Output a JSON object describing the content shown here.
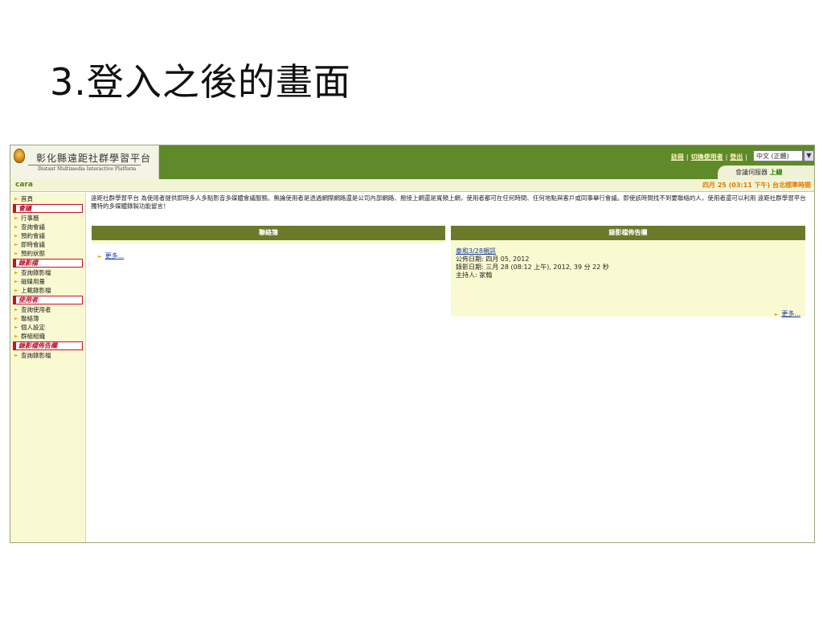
{
  "slide": {
    "title": "3.登入之後的畫面"
  },
  "header": {
    "brand_name": "彰化縣遠距社群學習平台",
    "brand_sub": "Distant Multimedia Interactive Platform",
    "links": [
      "註冊",
      "切換使用者",
      "登出"
    ],
    "language": "中文 (正體)",
    "server_label": "會議伺服器",
    "server_status": "上線"
  },
  "userbar": {
    "username": "cara",
    "datetime": "四月 25 (03:11 下午) 台北標準時間"
  },
  "sidebar": {
    "top": [
      {
        "label": "首頁"
      }
    ],
    "sections": [
      {
        "title": "會議",
        "items": [
          "行事曆",
          "查詢會議",
          "預約會議",
          "即時會議",
          "預約狀態"
        ]
      },
      {
        "title": "錄影檔",
        "items": [
          "查詢錄影檔",
          "磁碟用量",
          "上載錄影檔"
        ]
      },
      {
        "title": "使用者",
        "items": [
          "查詢使用者",
          "聯絡簿",
          "個人設定",
          "群組組織"
        ]
      },
      {
        "title": "錄影檔佈告欄",
        "items": [
          "查詢錄影檔"
        ]
      }
    ]
  },
  "main": {
    "intro": "遠距社群學習平台 為使用者提供即時多人多點影音多媒體會議服務。無論使用者是透過網際網路還是公司內部網路、撥接上網還是寬頻上網，使用者都可在任何時間、任何地點與客戶或同事舉行會議。即使該時間找不到要聯絡的人，使用者還可以利用 遠距社群學習平台 獨特的多媒體錄製功能留言！",
    "contacts_panel": {
      "title": "聯絡簿",
      "more": "更多..."
    },
    "recordings_panel": {
      "title": "錄影檔佈告欄",
      "record_title": "泰和3/28親訊",
      "published": "公佈日期: 四月 05, 2012",
      "recorded": "錄影日期: 三月 28 (08:12 上午), 2012, 39 分 22 秒",
      "host": "主持人: 家翰",
      "more": "更多..."
    }
  },
  "colors": {
    "header_green": "#5e8a2a",
    "panel_head": "#6b7a2a",
    "sidebar_bg": "#fafad2",
    "section_red": "#c0122c",
    "datetime_orange": "#e07a00"
  }
}
